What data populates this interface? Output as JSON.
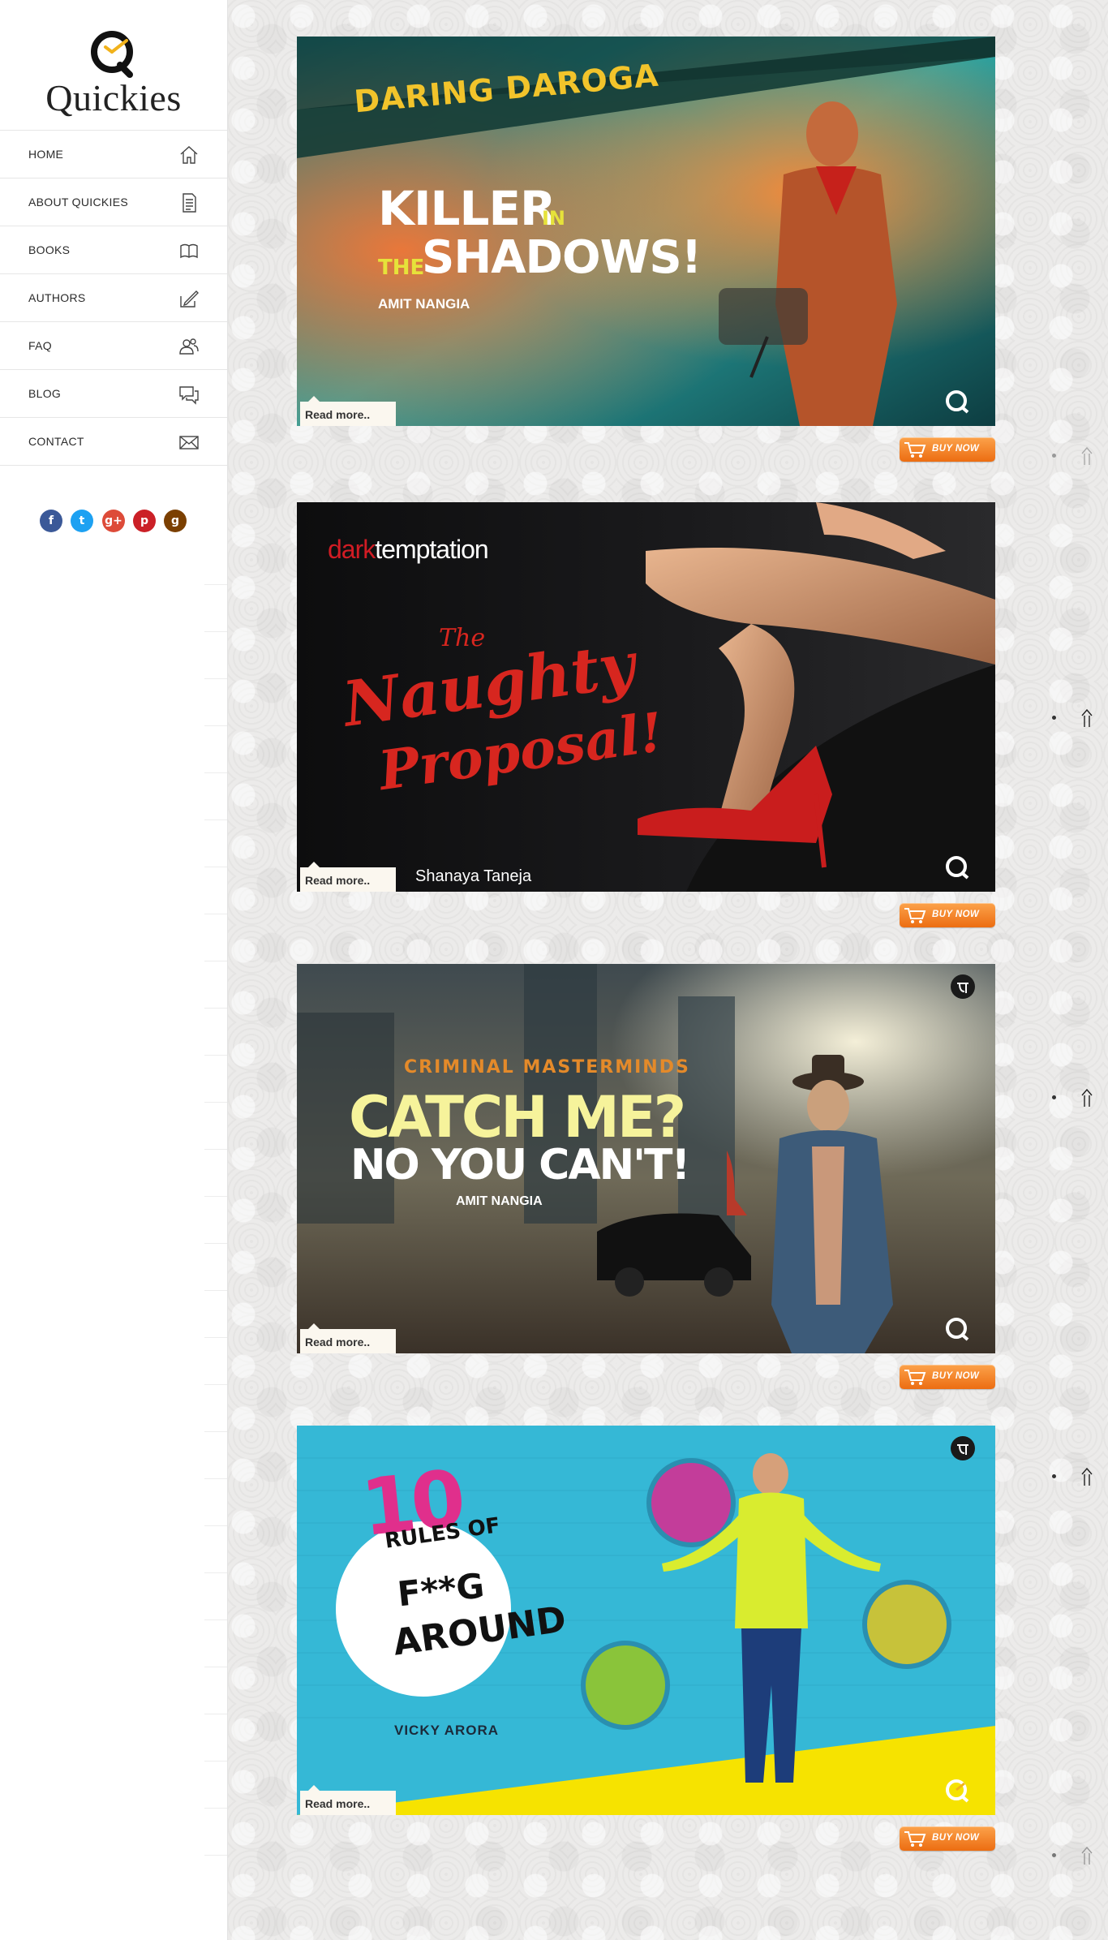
{
  "brand": {
    "name": "Quickies",
    "accent": "#f1b21b"
  },
  "nav": [
    {
      "label": "HOME",
      "icon": "home-icon"
    },
    {
      "label": "ABOUT QUICKIES",
      "icon": "document-icon"
    },
    {
      "label": "BOOKS",
      "icon": "books-icon"
    },
    {
      "label": "AUTHORS",
      "icon": "pen-icon"
    },
    {
      "label": "FAQ",
      "icon": "users-icon"
    },
    {
      "label": "BLOG",
      "icon": "chat-icon"
    },
    {
      "label": "CONTACT",
      "icon": "mail-icon"
    }
  ],
  "social": [
    {
      "name": "facebook",
      "glyph": "f",
      "color": "#3b5998"
    },
    {
      "name": "twitter",
      "glyph": "t",
      "color": "#1da1f2"
    },
    {
      "name": "google-plus",
      "glyph": "g+",
      "color": "#dd4b39"
    },
    {
      "name": "pinterest",
      "glyph": "p",
      "color": "#cb2027"
    },
    {
      "name": "goodreads",
      "glyph": "g",
      "color": "#7b3f00"
    }
  ],
  "books": [
    {
      "series": "DARING DAROGA",
      "title_line1": "KILLER",
      "title_small1": "IN",
      "title_small2": "THE",
      "title_line2": "SHADOWS!",
      "author": "AMIT NANGIA",
      "read_more": "Read more..",
      "buy": "BUY NOW"
    },
    {
      "imprint_a": "dark",
      "imprint_b": "temptation",
      "title_a": "The",
      "title_b": "Naughty",
      "title_c": "Proposal!",
      "author": "Shanaya Taneja",
      "read_more": "Read more..",
      "buy": "BUY NOW"
    },
    {
      "series": "CRIMINAL MASTERMINDS",
      "title_line1": "CATCH ME?",
      "title_line2": "NO YOU CAN'T!",
      "author": "AMIT NANGIA",
      "read_more": "Read more..",
      "buy": "BUY NOW"
    },
    {
      "number": "10",
      "title_line1": "RULES OF",
      "title_line2": "F**G",
      "title_line3": "AROUND",
      "author": "VICKY ARORA",
      "read_more": "Read more..",
      "buy": "BUY NOW"
    }
  ]
}
